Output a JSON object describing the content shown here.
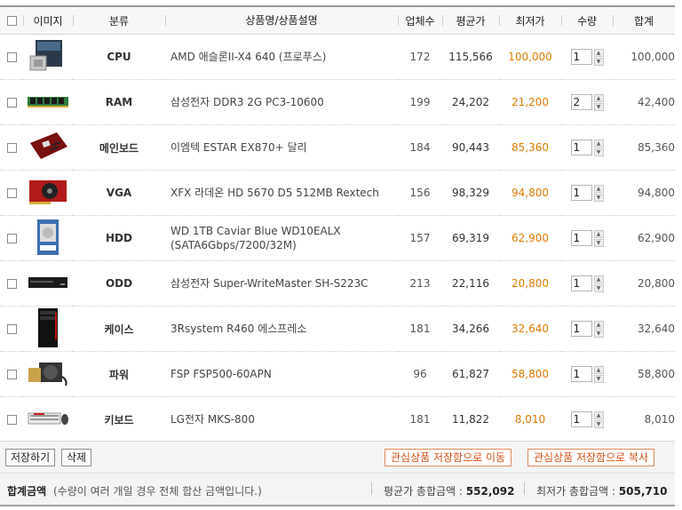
{
  "columns": [
    "이미지",
    "분류",
    "상품명/상품설명",
    "업체수",
    "평균가",
    "최저가",
    "수량",
    "합계"
  ],
  "rows": [
    {
      "category": "CPU",
      "name_lines": [
        "AMD 애슬론II-X4 640 (프로푸스)"
      ],
      "vendors": "172",
      "avg": "115,566",
      "low": "100,000",
      "qty": "1",
      "sum": "100,000",
      "image": "cpu-box-icon"
    },
    {
      "category": "RAM",
      "name_lines": [
        "삼성전자 DDR3 2G PC3-10600"
      ],
      "vendors": "199",
      "avg": "24,202",
      "low": "21,200",
      "qty": "2",
      "sum": "42,400",
      "image": "ram-stick-icon"
    },
    {
      "category": "메인보드",
      "name_lines": [
        "이엠텍 ESTAR EX870+ 달리"
      ],
      "vendors": "184",
      "avg": "90,443",
      "low": "85,360",
      "qty": "1",
      "sum": "85,360",
      "image": "motherboard-icon"
    },
    {
      "category": "VGA",
      "name_lines": [
        "XFX 라데온 HD 5670 D5 512MB Rextech"
      ],
      "vendors": "156",
      "avg": "98,329",
      "low": "94,800",
      "qty": "1",
      "sum": "94,800",
      "image": "graphics-card-icon"
    },
    {
      "category": "HDD",
      "name_lines": [
        "WD 1TB Caviar Blue WD10EALX",
        "(SATA6Gbps/7200/32M)"
      ],
      "vendors": "157",
      "avg": "69,319",
      "low": "62,900",
      "qty": "1",
      "sum": "62,900",
      "image": "hard-drive-icon"
    },
    {
      "category": "ODD",
      "name_lines": [
        "삼성전자 Super-WriteMaster SH-S223C"
      ],
      "vendors": "213",
      "avg": "22,116",
      "low": "20,800",
      "qty": "1",
      "sum": "20,800",
      "image": "optical-drive-icon"
    },
    {
      "category": "케이스",
      "name_lines": [
        "3Rsystem R460 에스프레소"
      ],
      "vendors": "181",
      "avg": "34,266",
      "low": "32,640",
      "qty": "1",
      "sum": "32,640",
      "image": "pc-case-icon"
    },
    {
      "category": "파워",
      "name_lines": [
        "FSP FSP500-60APN"
      ],
      "vendors": "96",
      "avg": "61,827",
      "low": "58,800",
      "qty": "1",
      "sum": "58,800",
      "image": "power-supply-icon"
    },
    {
      "category": "키보드",
      "name_lines": [
        "LG전자 MKS-800"
      ],
      "vendors": "181",
      "avg": "11,822",
      "low": "8,010",
      "qty": "1",
      "sum": "8,010",
      "image": "keyboard-icon"
    }
  ],
  "buttons": {
    "save": "저장하기",
    "delete": "삭제",
    "move_wishlist": "관심상품 저장함으로 이동",
    "copy_wishlist": "관심상품 저장함으로 복사"
  },
  "footer": {
    "label": "합계금액",
    "note": "(수량이 여러 개일 경우 전체 합산 금액입니다.)",
    "avg_total_label": "평균가 총합금액 : ",
    "avg_total_value": "552,092",
    "low_total_label": "최저가 총합금액 : ",
    "low_total_value": "505,710"
  },
  "colors": {
    "low_price": "#e07a00",
    "action_button": "#d2511a"
  }
}
